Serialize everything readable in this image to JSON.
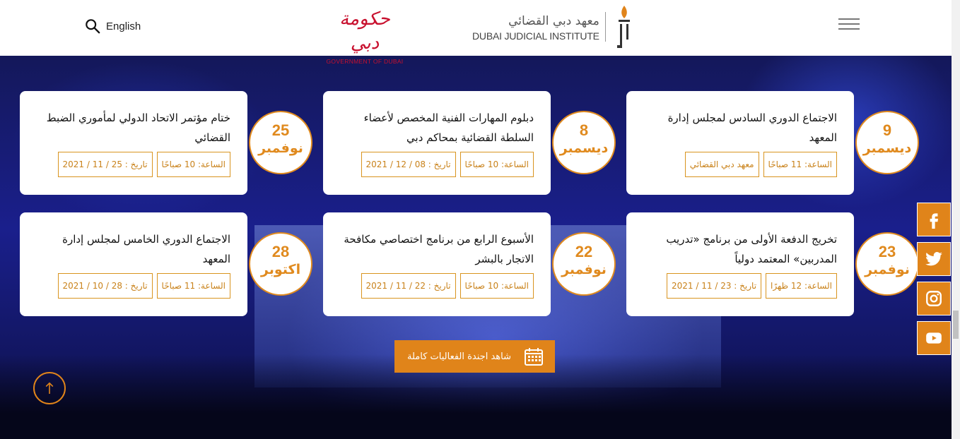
{
  "header": {
    "search_label": "English",
    "gov_logo_ar": "حكومة دبي",
    "gov_logo_en": "GOVERNMENT OF DUBAI",
    "dji_logo_ar": "معهد دبي القضائي",
    "dji_logo_en": "DUBAI JUDICIAL INSTITUTE"
  },
  "events": [
    {
      "title": "الاجتماع الدوري السادس لمجلس إدارة المعهد",
      "day": "9",
      "month": "ديسمبر",
      "tags": [
        "الساعة: 11 صباحًا",
        "معهد دبي القضائي"
      ]
    },
    {
      "title": "دبلوم المهارات الفنية المخصص لأعضاء السلطة القضائية بمحاكم دبي",
      "day": "8",
      "month": "ديسمبر",
      "tags": [
        "الساعة: 10 صباحًا",
        "تاريخ : 08 / 12 / 2021"
      ]
    },
    {
      "title": "ختام مؤتمر الاتحاد الدولي لمأموري الضبط القضائي",
      "day": "25",
      "month": "نوفمبر",
      "tags": [
        "الساعة: 10 صباحًا",
        "تاريخ : 25 / 11 / 2021"
      ]
    },
    {
      "title": "تخريج الدفعة الأولى من برنامج «تدريب المدربين» المعتمد دولياً",
      "day": "23",
      "month": "نوفمبر",
      "tags": [
        "الساعة: 12 ظهرًا",
        "تاريخ : 23 / 11 / 2021"
      ]
    },
    {
      "title": "الأسبوع الرابع من برنامج اختصاصي مكافحة الاتجار بالبشر",
      "day": "22",
      "month": "نوفمبر",
      "tags": [
        "الساعة: 10 صباحًا",
        "تاريخ : 22 / 11 / 2021"
      ]
    },
    {
      "title": "الاجتماع الدوري الخامس لمجلس إدارة المعهد",
      "day": "28",
      "month": "اكتوبر",
      "tags": [
        "الساعة: 11 صباحًا",
        "تاريخ : 28 / 10 / 2021"
      ]
    }
  ],
  "agenda_label": "شاهد اجندة الفعاليات كاملة",
  "colors": {
    "accent": "#e0841a",
    "brand_red": "#c8102e"
  },
  "social": [
    "facebook-icon",
    "twitter-icon",
    "instagram-icon",
    "youtube-icon"
  ]
}
